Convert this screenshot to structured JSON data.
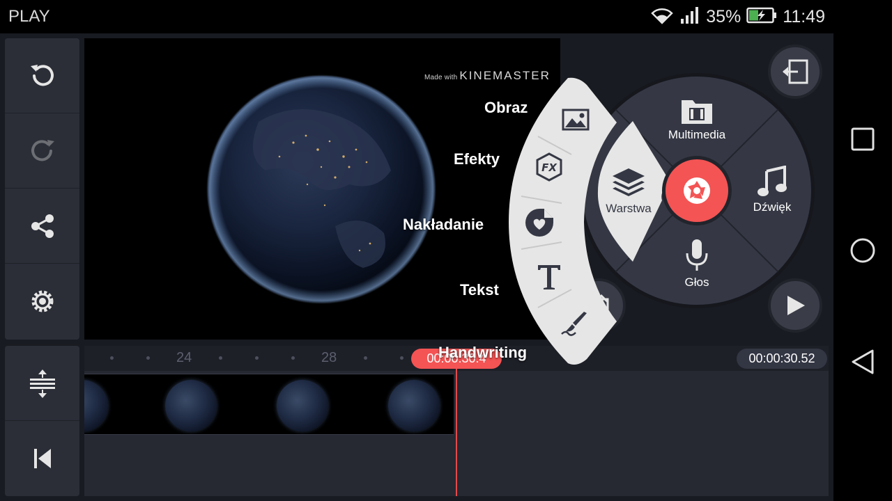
{
  "status_bar": {
    "app_name": "PLAY",
    "battery": "35%",
    "time": "11:49"
  },
  "preview": {
    "watermark_prefix": "Made with",
    "watermark_brand": "KINEMASTER"
  },
  "layer_menu": {
    "items": [
      {
        "label": "Obraz",
        "icon": "image-icon"
      },
      {
        "label": "Efekty",
        "icon": "fx-icon"
      },
      {
        "label": "Nakładanie",
        "icon": "sticker-icon"
      },
      {
        "label": "Tekst",
        "icon": "text-icon"
      },
      {
        "label": "Handwriting",
        "icon": "brush-icon"
      }
    ]
  },
  "media_wheel": {
    "multimedia_label": "Multimedia",
    "layer_label": "Warstwa",
    "audio_label": "Dźwięk",
    "voice_label": "Głos"
  },
  "timeline": {
    "ruler_labels": [
      "24",
      "28"
    ],
    "current_time": "00:00:30.4",
    "total_time": "00:00:30.52"
  },
  "colors": {
    "accent": "#f45454",
    "panel": "#2b2e37",
    "background": "#191b22",
    "menu_surface": "#e6e6e6"
  }
}
